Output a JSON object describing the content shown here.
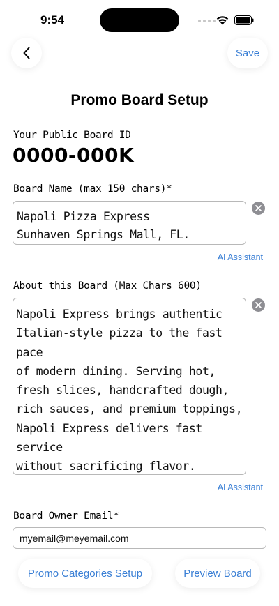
{
  "status_bar": {
    "time": "9:54"
  },
  "nav": {
    "save_label": "Save"
  },
  "page": {
    "title": "Promo Board Setup"
  },
  "board_id": {
    "label": "Your Public Board ID",
    "value": "0000-000K"
  },
  "board_name": {
    "label": "Board Name (max 150 chars)*",
    "value": "Napoli Pizza Express\nSunhaven Springs Mall, FL.",
    "ai_label": "AI Assistant"
  },
  "about": {
    "label": "About this Board (Max Chars 600)",
    "value": "Napoli Express brings authentic\nItalian-style pizza to the fast pace\nof modern dining. Serving hot,\nfresh slices, handcrafted dough,\nrich sauces, and premium toppings,\nNapoli Express delivers fast service\nwithout sacrificing flavor. Inspired\nby the traditions of Naples, Italy,\nwe offer oven-baked pizzas and",
    "ai_label": "AI Assistant"
  },
  "email": {
    "label": "Board Owner Email*",
    "value": "myemail@meyemail.com"
  },
  "buttons": {
    "promo_categories": "Promo Categories Setup",
    "preview": "Preview Board"
  },
  "colors": {
    "accent": "#3a7fd5",
    "clear_icon": "#8e8e93"
  }
}
